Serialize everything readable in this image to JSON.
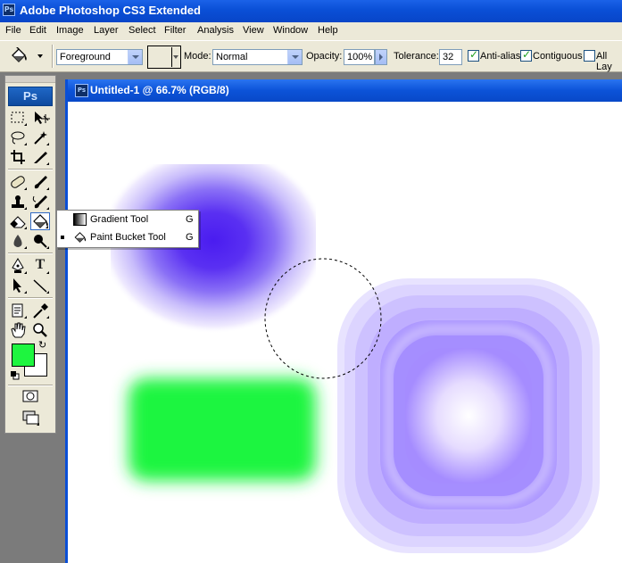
{
  "app": {
    "title": "Adobe Photoshop CS3 Extended",
    "logo_text": "Ps"
  },
  "menu": [
    "File",
    "Edit",
    "Image",
    "Layer",
    "Select",
    "Filter",
    "Analysis",
    "View",
    "Window",
    "Help"
  ],
  "options": {
    "fill_source": "Foreground",
    "mode_label": "Mode:",
    "mode_value": "Normal",
    "opacity_label": "Opacity:",
    "opacity_value": "100%",
    "tolerance_label": "Tolerance:",
    "tolerance_value": "32",
    "anti_alias_label": "Anti-alias",
    "anti_alias_checked": true,
    "contiguous_label": "Contiguous",
    "contiguous_checked": true,
    "all_layers_label": "All Lay",
    "all_layers_checked": false
  },
  "toolbox": {
    "logo_text": "Ps",
    "foreground_color": "#1ef53f",
    "background_color": "#ffffff"
  },
  "flyout": {
    "items": [
      {
        "label": "Gradient Tool",
        "key": "G",
        "selected": false
      },
      {
        "label": "Paint Bucket Tool",
        "key": "G",
        "selected": true
      }
    ]
  },
  "document": {
    "title": "Untitled-1 @ 66.7% (RGB/8)",
    "icon_text": "Ps"
  },
  "colors": {
    "title_bar": "#0a4fd6",
    "purple_blob": "#5a2df0",
    "green_rect": "#1ef53f",
    "lavender_square": "#a996ff"
  }
}
